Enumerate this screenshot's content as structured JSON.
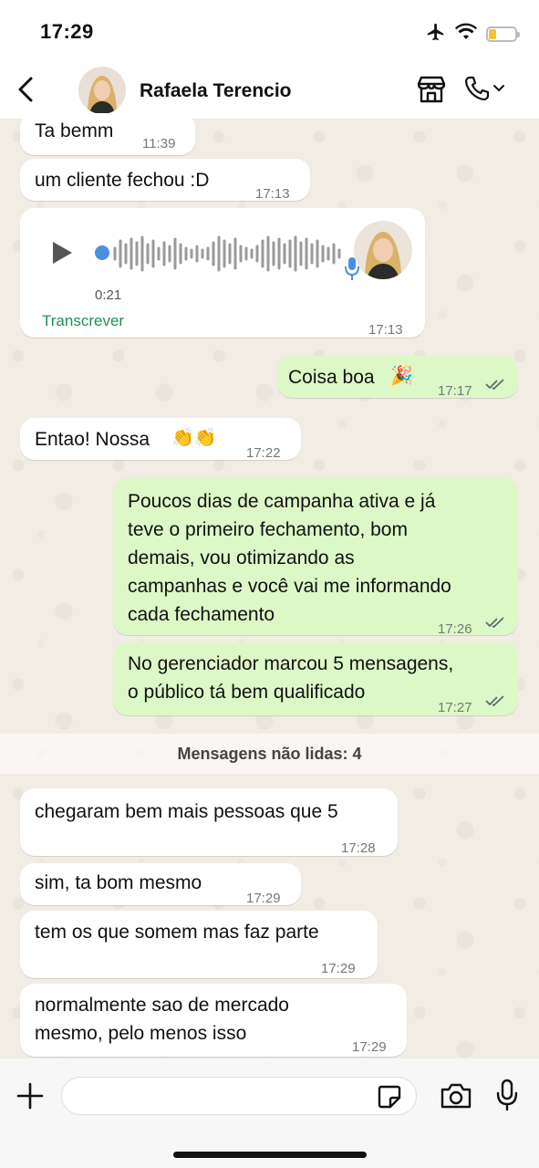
{
  "status_bar": {
    "time": "17:29"
  },
  "header": {
    "contact_name": "Rafaela Terencio"
  },
  "messages": [
    {
      "type": "text",
      "direction": "in",
      "text": "Ta bemm",
      "time": "11:39"
    },
    {
      "type": "text",
      "direction": "in",
      "text": "um cliente fechou :D",
      "time": "17:13"
    },
    {
      "type": "voice",
      "direction": "in",
      "duration": "0:21",
      "transcribe_label": "Transcrever",
      "time": "17:13"
    },
    {
      "type": "text",
      "direction": "out",
      "text": "Coisa boa",
      "emoji": "🎉",
      "time": "17:17",
      "read": true
    },
    {
      "type": "text",
      "direction": "in",
      "text": "Entao! Nossa",
      "emoji": "👏👏",
      "time": "17:22"
    },
    {
      "type": "text",
      "direction": "out",
      "lines": [
        "Poucos dias de campanha ativa e já",
        "teve o primeiro fechamento, bom",
        "demais, vou otimizando as",
        "campanhas e você vai me informando",
        "cada fechamento"
      ],
      "time": "17:26",
      "read": true
    },
    {
      "type": "text",
      "direction": "out",
      "lines": [
        "No gerenciador marcou 5 mensagens,",
        "o público tá bem qualificado"
      ],
      "time": "17:27",
      "read": true
    },
    {
      "type": "text",
      "direction": "in",
      "text": "chegaram bem mais pessoas que 5",
      "time": "17:28"
    },
    {
      "type": "text",
      "direction": "in",
      "text": "sim, ta bom mesmo",
      "time": "17:29"
    },
    {
      "type": "text",
      "direction": "in",
      "text": "tem os que somem mas faz parte",
      "time": "17:29"
    },
    {
      "type": "text",
      "direction": "in",
      "lines": [
        "normalmente sao de mercado",
        "mesmo, pelo menos isso"
      ],
      "time": "17:29"
    }
  ],
  "unread_divider": "Mensagens não lidas: 4",
  "input": {
    "value": "",
    "placeholder": ""
  },
  "icons": {
    "back": "chevron-left-icon",
    "store": "store-icon",
    "call": "phone-icon",
    "plus": "plus-icon",
    "sticker": "sticker-icon",
    "camera": "camera-icon",
    "mic": "microphone-icon"
  },
  "colors": {
    "incoming_bubble": "#ffffff",
    "outgoing_bubble": "#dcf8c6",
    "wallpaper": "#efeae2",
    "transcribe_link": "#1e8f5a",
    "voice_dot": "#4a90e2",
    "battery_fill": "#f4c430"
  }
}
